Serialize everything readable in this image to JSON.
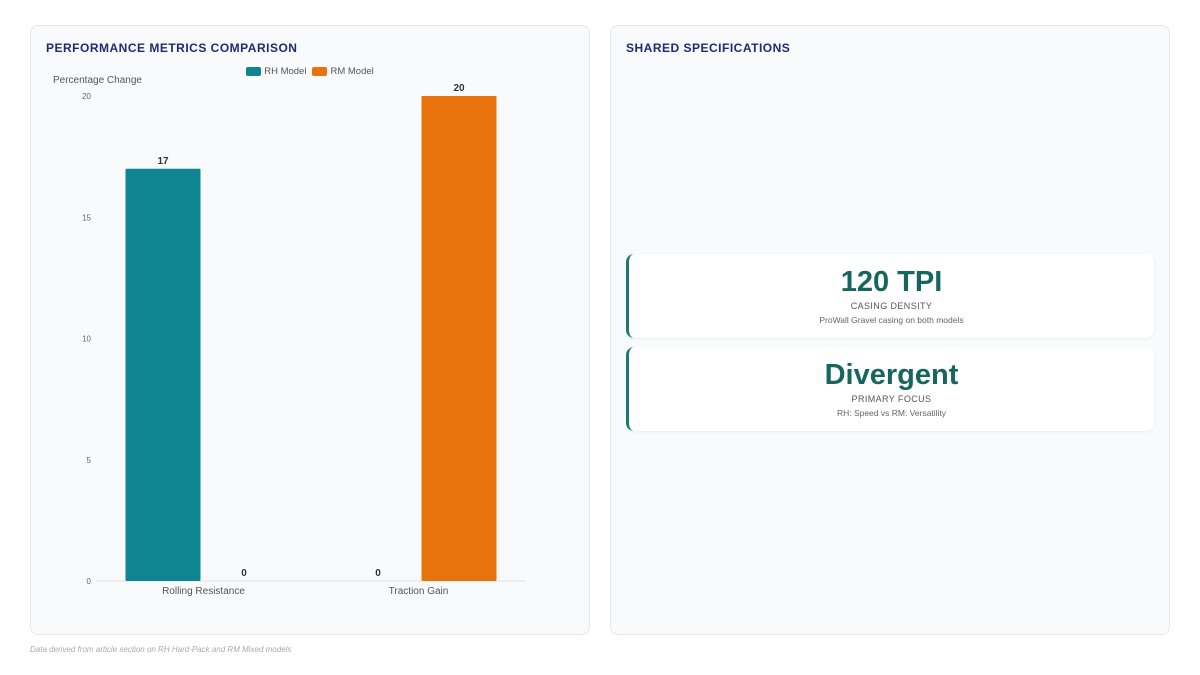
{
  "chart_panel": {
    "title": "PERFORMANCE METRICS COMPARISON"
  },
  "specs_panel": {
    "title": "SHARED SPECIFICATIONS",
    "cards": [
      {
        "value": "120 TPI",
        "label": "CASING DENSITY",
        "note": "ProWall Gravel casing on both models"
      },
      {
        "value": "Divergent",
        "label": "PRIMARY FOCUS",
        "note": "RH: Speed vs RM: Versatility"
      }
    ],
    "accent_color": "#1a7a73"
  },
  "footer": {
    "note": "Data derived from article section on RH Hard-Pack and RM Mixed models"
  },
  "chart_data": {
    "type": "bar",
    "title": "",
    "xlabel": "",
    "ylabel": "Percentage Change",
    "categories": [
      "Rolling Resistance",
      "Traction Gain"
    ],
    "series": [
      {
        "name": "RH Model",
        "values": [
          17,
          0
        ],
        "color": "#0e8590"
      },
      {
        "name": "RM Model",
        "values": [
          0,
          20
        ],
        "color": "#e8730c"
      }
    ],
    "ylim": [
      0,
      20
    ],
    "yticks": [
      0,
      5,
      10,
      15,
      20
    ],
    "legend_position": "top-center",
    "grid": false,
    "data_labels": true
  }
}
